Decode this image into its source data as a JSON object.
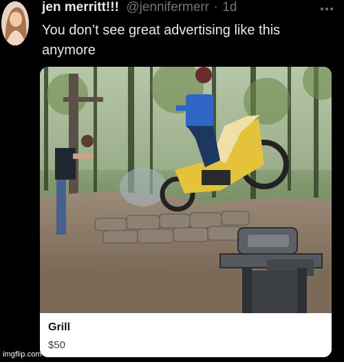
{
  "tweet": {
    "author_name": "jen merritt!!!",
    "handle": "@jennifermerr",
    "separator": "·",
    "timestamp": "1d",
    "text": "You don’t see great advertising like this anymore",
    "more_icon": "more-dots-icon"
  },
  "card": {
    "image_subject": "dirt-bike-jump-over-grill-photo",
    "title": "Grill",
    "price": "$50"
  },
  "watermark": {
    "text": "imgflip.com"
  }
}
